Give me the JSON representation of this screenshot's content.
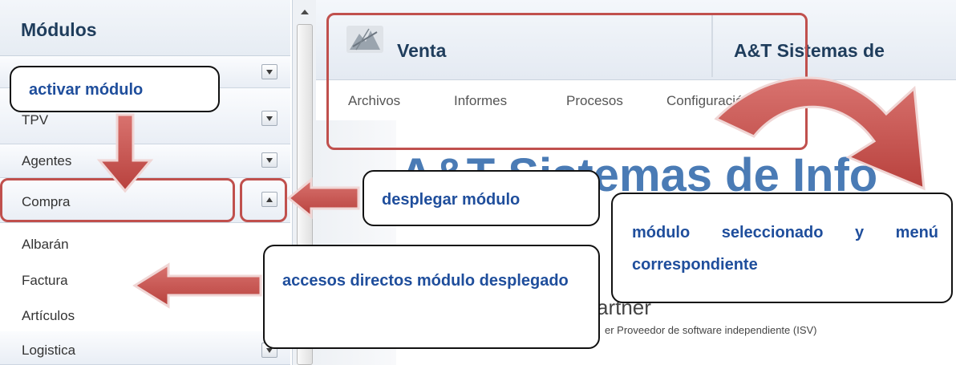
{
  "sidebar": {
    "title": "Módulos",
    "modules": [
      {
        "label": "TPV",
        "state": "collapsed"
      },
      {
        "label": "Agentes",
        "state": "collapsed"
      },
      {
        "label": "Compra",
        "state": "expanded"
      },
      {
        "label": "Logistica",
        "state": "collapsed"
      }
    ],
    "links": [
      "Albarán",
      "Factura",
      "Artículos"
    ]
  },
  "main": {
    "module_title": "Venta",
    "company_title": "A&T Sistemas de",
    "menu": [
      "Archivos",
      "Informes",
      "Procesos",
      "Configuración"
    ],
    "banner_text": "A&T Sistemas de Info",
    "partner_text": "artner",
    "isv_text": "er Proveedor de software independiente (ISV)"
  },
  "annotations": {
    "activate": "activar módulo",
    "expand": "desplegar módulo",
    "selected": "módulo seleccionado y menú correspondiente",
    "shortcuts": "accesos directos módulo desplegado"
  },
  "colors": {
    "annotation_red": "#c0504d",
    "annotation_text": "#1f4e9c",
    "header_text": "#1f3d5c"
  }
}
